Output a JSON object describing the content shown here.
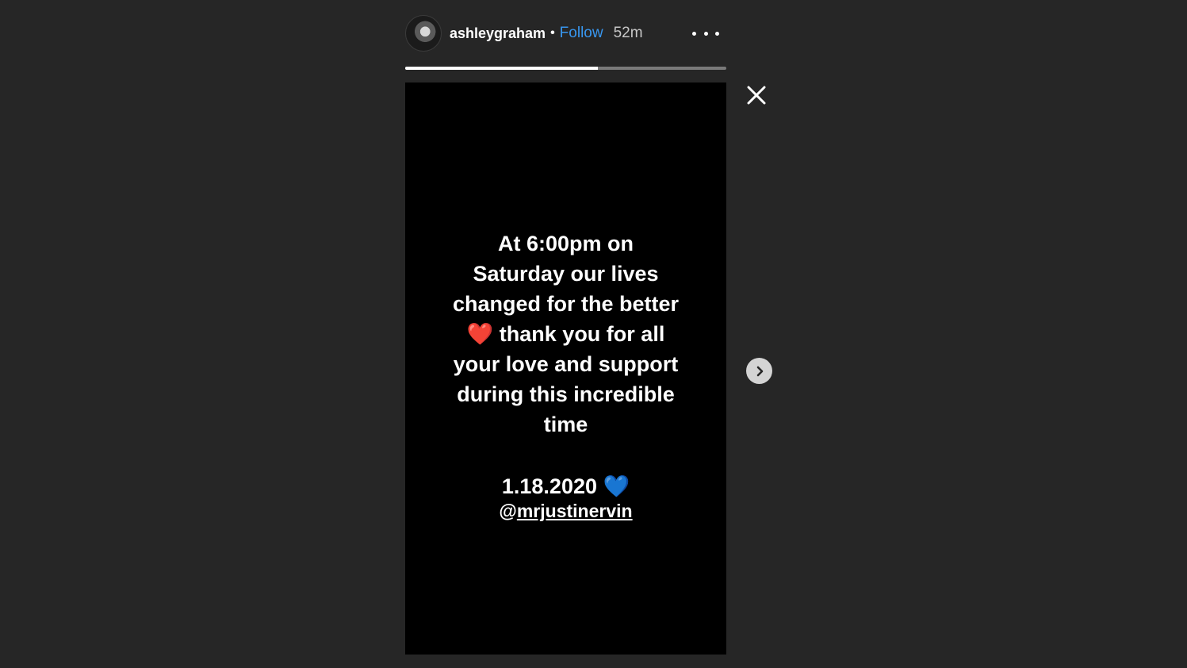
{
  "header": {
    "username": "ashleygraham",
    "separator": "•",
    "follow_label": "Follow",
    "time_ago": "52m"
  },
  "progress": {
    "segment_fraction": 0.6
  },
  "story": {
    "message": "At 6:00pm on\nSaturday our lives\nchanged for the better\n❤️ thank you for all\nyour love and support\nduring this incredible\ntime",
    "date_line": "1.18.2020 💙",
    "mention_at": "@",
    "mention_handle": "mrjustinervin"
  },
  "icons": {
    "more": "more-horizontal-icon",
    "close": "close-icon",
    "next": "chevron-right-icon"
  },
  "colors": {
    "background": "#262626",
    "follow": "#3897f0",
    "story_bg": "#000000"
  }
}
